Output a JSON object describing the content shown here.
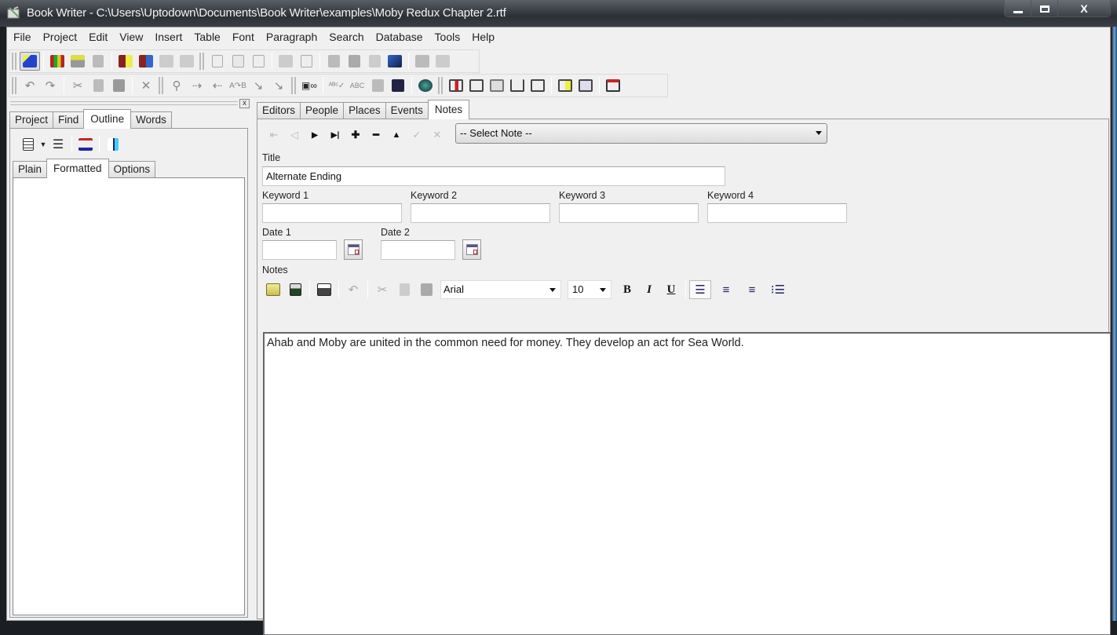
{
  "window": {
    "title": "Book Writer - C:\\Users\\Uptodown\\Documents\\Book Writer\\examples\\Moby Redux Chapter 2.rtf",
    "minimize_label": "▁",
    "maximize_label": "□",
    "close_label": "X"
  },
  "menu": [
    "File",
    "Project",
    "Edit",
    "View",
    "Insert",
    "Table",
    "Font",
    "Paragraph",
    "Search",
    "Database",
    "Tools",
    "Help"
  ],
  "toolbar1": {
    "icons": [
      "project-wizard-icon",
      "library-books-icon",
      "printer-stack-icon",
      "export-icon",
      "new-chapter-icon",
      "add-remove-chapter-icon",
      "insert-chapter-icon",
      "remove-chapter-icon",
      "new-document-icon",
      "template-icon",
      "text-format-icon",
      "open-folder-icon",
      "document-list-icon",
      "save-icon",
      "save-all-icon",
      "send-icon",
      "publish-icon",
      "print-icon",
      "print-preview-icon"
    ]
  },
  "toolbar2": {
    "icons": [
      "undo-icon",
      "redo-icon",
      "cut-icon",
      "copy-icon",
      "paste-icon",
      "delete-icon",
      "find-icon",
      "find-next-icon",
      "find-previous-icon",
      "replace-icon",
      "goto-icon",
      "goto-line-icon",
      "format-symbols-icon",
      "spellcheck-icon",
      "spellcheck-as-you-type-icon",
      "thesaurus-icon",
      "word-count-icon",
      "web-globe-icon",
      "insert-table-icon",
      "insert-row-icon",
      "table-properties-icon",
      "merge-cells-icon",
      "split-cells-icon",
      "cell-properties-icon",
      "table-preview-icon",
      "table-tools-icon"
    ]
  },
  "left_panel": {
    "close_label": "x",
    "tabs": [
      {
        "label": "Project",
        "selected": false
      },
      {
        "label": "Find",
        "selected": false
      },
      {
        "label": "Outline",
        "selected": true
      },
      {
        "label": "Words",
        "selected": false
      }
    ],
    "subtabs": [
      {
        "label": "Plain",
        "selected": false
      },
      {
        "label": "Formatted",
        "selected": true
      },
      {
        "label": "Options",
        "selected": false
      }
    ]
  },
  "right_panel": {
    "tabs": [
      {
        "label": "Editors",
        "selected": false
      },
      {
        "label": "People",
        "selected": false
      },
      {
        "label": "Places",
        "selected": false
      },
      {
        "label": "Events",
        "selected": false
      },
      {
        "label": "Notes",
        "selected": true
      }
    ],
    "nav_buttons": [
      {
        "name": "first-record-button",
        "glyph": "⇤",
        "enabled": false
      },
      {
        "name": "prev-record-button",
        "glyph": "◁",
        "enabled": false
      },
      {
        "name": "next-record-button",
        "glyph": "▶",
        "enabled": true
      },
      {
        "name": "last-record-button",
        "glyph": "▶|",
        "enabled": true
      },
      {
        "name": "add-record-button",
        "glyph": "✚",
        "enabled": true
      },
      {
        "name": "delete-record-button",
        "glyph": "━",
        "enabled": true
      },
      {
        "name": "edit-record-button",
        "glyph": "▲",
        "enabled": true
      },
      {
        "name": "post-record-button",
        "glyph": "✓",
        "enabled": false
      },
      {
        "name": "cancel-record-button",
        "glyph": "✕",
        "enabled": false
      }
    ],
    "select_note": "-- Select Note --",
    "title_label": "Title",
    "title_value": "Alternate Ending",
    "keywords": [
      {
        "label": "Keyword 1",
        "value": ""
      },
      {
        "label": "Keyword 2",
        "value": ""
      },
      {
        "label": "Keyword 3",
        "value": ""
      },
      {
        "label": "Keyword 4",
        "value": ""
      }
    ],
    "date1_label": "Date 1",
    "date1_value": "",
    "date2_label": "Date 2",
    "date2_value": "",
    "notes_label": "Notes",
    "font_name": "Arial",
    "font_size": "10",
    "bold_label": "B",
    "italic_label": "I",
    "underline_label": "U",
    "notes_text": "Ahab and Moby are united in the common need for money.  They develop an act for Sea World."
  }
}
